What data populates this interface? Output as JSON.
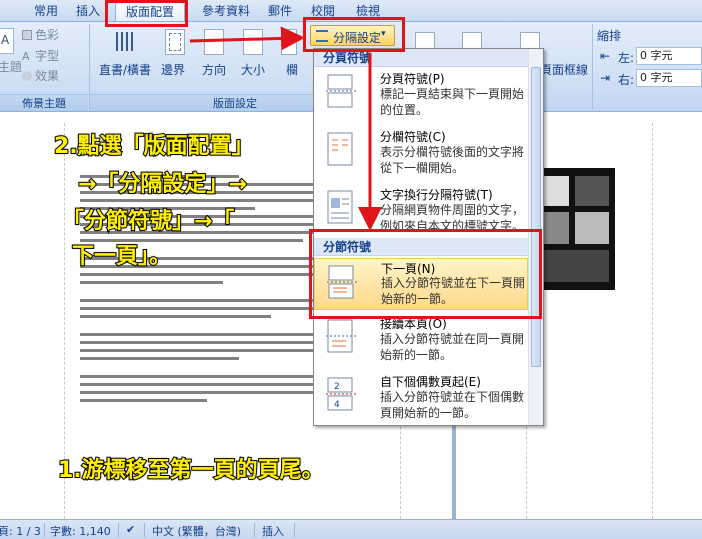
{
  "tabs": [
    "常用",
    "插入",
    "版面配置",
    "參考資料",
    "郵件",
    "校閱",
    "檢視"
  ],
  "ribbon": {
    "theme_group": {
      "items": [
        "色彩",
        "字型",
        "效果"
      ],
      "left_label": "主題",
      "label": "佈景主題"
    },
    "page_setup_group": {
      "buttons": [
        "直書/橫書",
        "邊界",
        "方向",
        "大小",
        "欄"
      ],
      "label": "版面設定"
    },
    "breaks_button": "分隔設定",
    "breaks_arrow": "▾",
    "right_section": {
      "buttons": [
        "頁面框線"
      ],
      "indent_label": "縮排",
      "left_label": "左:",
      "left_value": "0 字元",
      "right_label": "右:",
      "right_value": "0 字元"
    }
  },
  "dropdown": {
    "page_breaks_header": "分頁符號",
    "page_breaks": [
      {
        "title": "分頁符號(P)",
        "desc": "標記一頁結束與下一頁開始的位置。"
      },
      {
        "title": "分欄符號(C)",
        "desc": "表示分欄符號後面的文字將從下一欄開始。"
      },
      {
        "title": "文字換行分隔符號(T)",
        "desc": "分隔網頁物件周圍的文字，例如來自本文的標號文字。"
      }
    ],
    "section_breaks_header": "分節符號",
    "section_breaks": [
      {
        "title": "下一頁(N)",
        "desc": "插入分節符號並在下一頁開始新的一節。"
      },
      {
        "title": "接續本頁(O)",
        "desc": "插入分節符號並在同一頁開始新的一節。"
      },
      {
        "title": "自下個偶數頁起(E)",
        "desc": "插入分節符號並在下個偶數頁開始新的一節。"
      }
    ]
  },
  "annotations": {
    "step2_line1": "2.點選「版面配置」",
    "step2_line2": "→「分隔設定」→",
    "step2_line3": "「分節符號」→「",
    "step2_line4": "下一頁」。",
    "step1": "1.游標移至第一頁的頁尾。"
  },
  "status": {
    "page": "頁: 1 / 3",
    "words": "字數: 1,140",
    "language": "中文 (繁體，台灣)",
    "mode": "插入"
  },
  "colors": {
    "accent_red": "#e0141b",
    "annotation_yellow": "#fff000",
    "ribbon_text": "#15428b"
  }
}
